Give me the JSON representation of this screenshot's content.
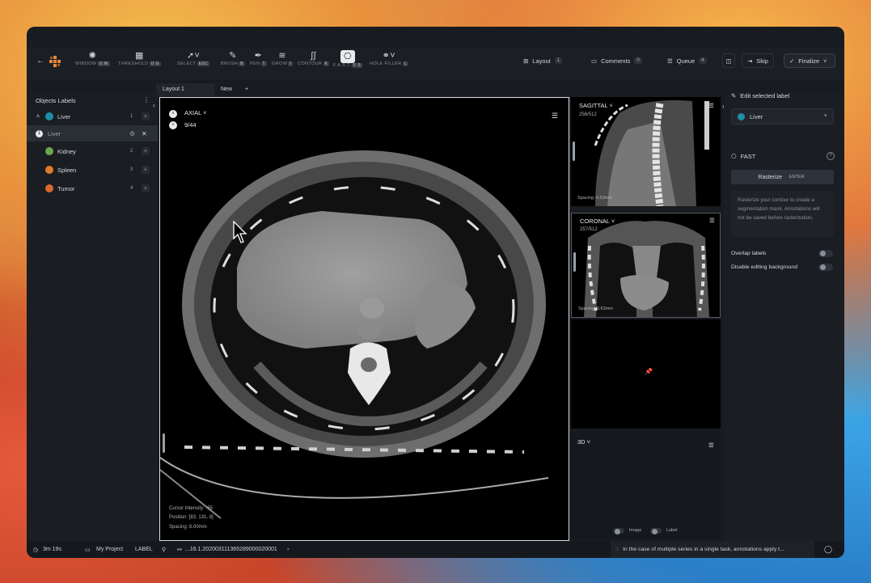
{
  "toolbar": {
    "tools": [
      {
        "label": "WINDOW",
        "keys": "O W",
        "icon": "sun-icon"
      },
      {
        "label": "THRESHOLD",
        "keys": "O G",
        "icon": "grid-icon"
      },
      {
        "label": "SELECT",
        "keys": "ESC",
        "icon": "cursor-icon"
      },
      {
        "label": "BRUSH",
        "keys": "B",
        "icon": "brush-icon"
      },
      {
        "label": "PEN",
        "keys": "T",
        "icon": "pen-icon"
      },
      {
        "label": "GROW",
        "keys": "I",
        "icon": "grow-icon"
      },
      {
        "label": "CONTOUR",
        "keys": "K",
        "icon": "contour-icon"
      },
      {
        "label": "F.A.S.T.",
        "keys": "F S",
        "icon": "fast-icon"
      },
      {
        "label": "HOLE FILLER",
        "keys": "L",
        "icon": "hole-filler-icon"
      }
    ],
    "layout_label": "Layout",
    "layout_count": "1",
    "comments_label": "Comments",
    "comments_count": "0",
    "queue_label": "Queue",
    "queue_count": "4",
    "skip_label": "Skip",
    "finalize_label": "Finalize"
  },
  "tabs": {
    "layout1": "Layout 1",
    "new": "New",
    "add": "+"
  },
  "left": {
    "title": "Objects Labels",
    "labels": [
      {
        "name": "Liver",
        "count": "1"
      },
      {
        "name": "Liver",
        "instance": "1"
      },
      {
        "name": "Kidney",
        "count": "2"
      },
      {
        "name": "Spleen",
        "count": "3"
      },
      {
        "name": "Tumor",
        "count": "4"
      }
    ]
  },
  "axial": {
    "title": "AXIAL",
    "slice": "9/44",
    "cursor_intensity": "Cursor Intensity: -55",
    "position": "Position: [83, 131, 8]",
    "spacing": "Spacing: 6.00mm"
  },
  "sagittal": {
    "title": "SAGITTAL",
    "slice": "256/512",
    "spacing": "Spacing: 0.63mm"
  },
  "coronal": {
    "title": "CORONAL",
    "slice": "257/512",
    "spacing": "Spacing: 0.63mm"
  },
  "view3d": {
    "title": "3D",
    "image_label": "Image",
    "label_label": "Label"
  },
  "right": {
    "edit_title": "Edit selected label",
    "selected": "Liver",
    "fast_title": "FAST",
    "rasterize": "Rasterize",
    "rasterize_key": "ENTER",
    "info": "Rasterize your contour to create a segmentation mask. Annotations will not be saved before rasterization.",
    "overlap": "Overlap labels",
    "disable_bg": "Disable editing background"
  },
  "status": {
    "timer": "3m 19s",
    "project": "My Project",
    "mode": "LABEL",
    "series": "...16.1.20200311136528900002000​1",
    "notice": "In the case of multiple series in a single task, annotations apply t..."
  },
  "colors": {
    "liver": "#1d8fa8",
    "kidney": "#6aa84f",
    "spleen": "#e07a2a",
    "tumor": "#e07a2a",
    "accent": "#e8863a"
  }
}
